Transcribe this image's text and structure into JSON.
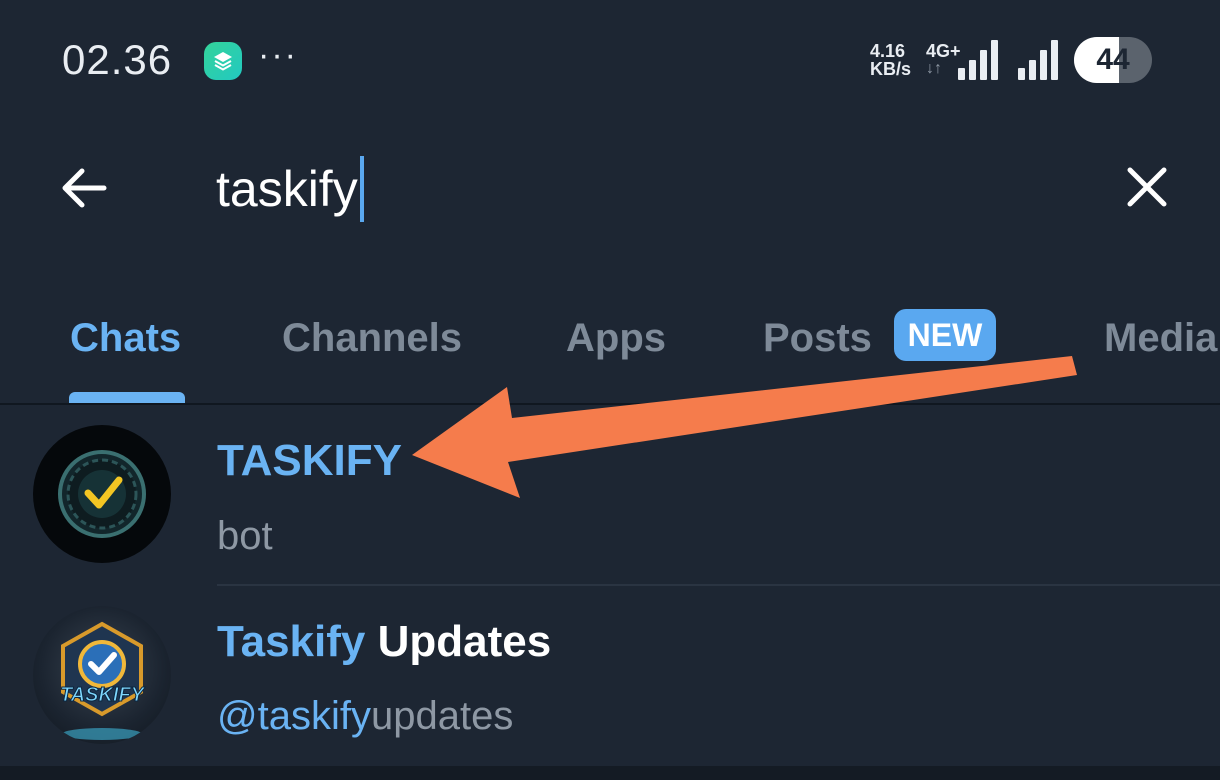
{
  "status_bar": {
    "time": "02.36",
    "more": "···",
    "net_speed_value": "4.16",
    "net_speed_unit": "KB/s",
    "network_type": "4G+",
    "battery_level": "44",
    "icons": [
      "app-icon",
      "signal-icon",
      "battery-icon"
    ]
  },
  "search": {
    "query": "taskify",
    "back_icon": "arrow-left-icon",
    "clear_icon": "close-icon"
  },
  "tabs": [
    {
      "label": "Chats",
      "active": true
    },
    {
      "label": "Channels"
    },
    {
      "label": "Apps"
    },
    {
      "label": "Posts",
      "badge": "NEW"
    },
    {
      "label": "Media"
    }
  ],
  "results": [
    {
      "title_highlight": "TASKIFY",
      "title_rest": "",
      "subtitle_highlight": "",
      "subtitle_rest": "bot",
      "avatar_icon": "checkmark-badge-icon"
    },
    {
      "title_highlight": "Taskify",
      "title_rest": " Updates",
      "subtitle_highlight": "@taskify",
      "subtitle_rest": "updates",
      "avatar_text": "TASKIFY",
      "avatar_icon": "checkmark-hexagon-icon"
    }
  ],
  "colors": {
    "background": "#1d2633",
    "accent": "#6ab3f3",
    "muted": "#7e8a98",
    "annotation_arrow": "#f57c4c"
  }
}
